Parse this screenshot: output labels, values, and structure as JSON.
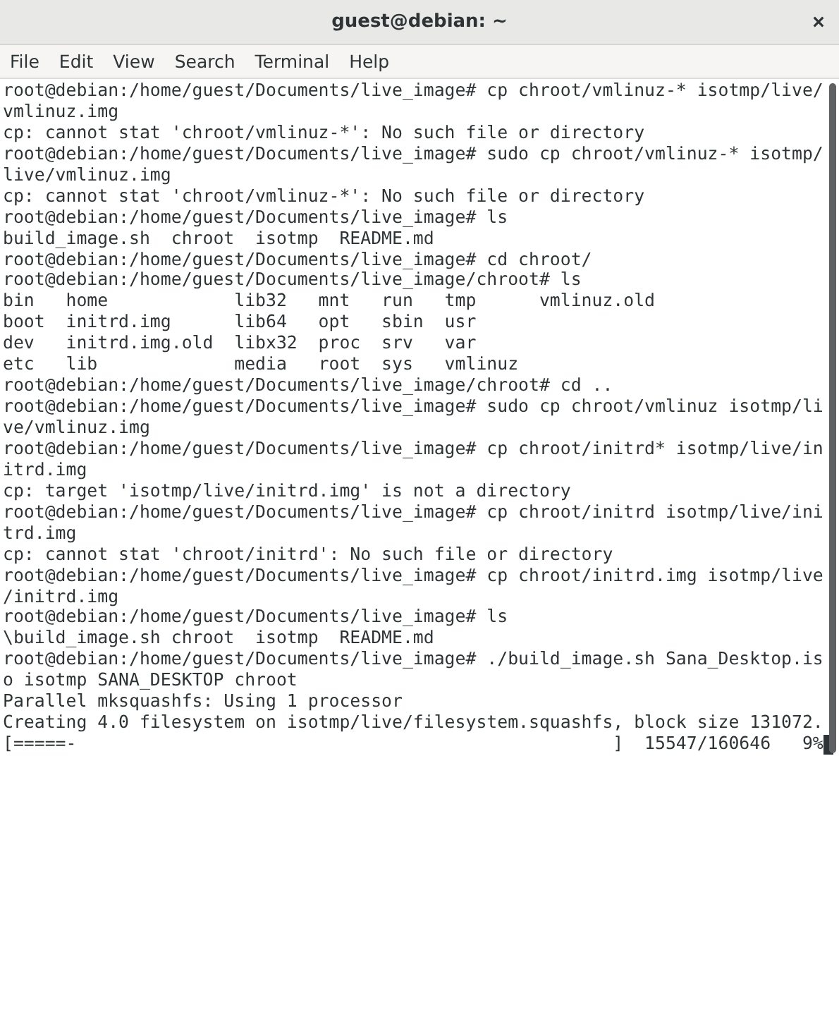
{
  "window": {
    "title": "guest@debian: ~"
  },
  "menu": [
    "File",
    "Edit",
    "View",
    "Search",
    "Terminal",
    "Help"
  ],
  "terminal": {
    "lines": [
      "root@debian:/home/guest/Documents/live_image# cp chroot/vmlinuz-* isotmp/live/",
      "vmlinuz.img",
      "cp: cannot stat 'chroot/vmlinuz-*': No such file or directory",
      "root@debian:/home/guest/Documents/live_image# sudo cp chroot/vmlinuz-* isotmp/",
      "live/vmlinuz.img",
      "cp: cannot stat 'chroot/vmlinuz-*': No such file or directory",
      "root@debian:/home/guest/Documents/live_image# ls",
      "build_image.sh  chroot  isotmp  README.md",
      "root@debian:/home/guest/Documents/live_image# cd chroot/",
      "root@debian:/home/guest/Documents/live_image/chroot# ls",
      "bin   home            lib32   mnt   run   tmp      vmlinuz.old",
      "boot  initrd.img      lib64   opt   sbin  usr",
      "dev   initrd.img.old  libx32  proc  srv   var",
      "etc   lib             media   root  sys   vmlinuz",
      "root@debian:/home/guest/Documents/live_image/chroot# cd ..",
      "root@debian:/home/guest/Documents/live_image# sudo cp chroot/vmlinuz isotmp/li",
      "ve/vmlinuz.img",
      "root@debian:/home/guest/Documents/live_image# cp chroot/initrd* isotmp/live/in",
      "itrd.img",
      "cp: target 'isotmp/live/initrd.img' is not a directory",
      "root@debian:/home/guest/Documents/live_image# cp chroot/initrd isotmp/live/ini",
      "trd.img",
      "cp: cannot stat 'chroot/initrd': No such file or directory",
      "root@debian:/home/guest/Documents/live_image# cp chroot/initrd.img isotmp/live",
      "/initrd.img",
      "root@debian:/home/guest/Documents/live_image# ls",
      "\\build_image.sh chroot  isotmp  README.md",
      "root@debian:/home/guest/Documents/live_image# ./build_image.sh Sana_Desktop.is",
      "o isotmp SANA_DESKTOP chroot",
      "Parallel mksquashfs: Using 1 processor",
      "Creating 4.0 filesystem on isotmp/live/filesystem.squashfs, block size 131072.",
      "[=====-                                                   ]  15547/160646   9%"
    ]
  }
}
